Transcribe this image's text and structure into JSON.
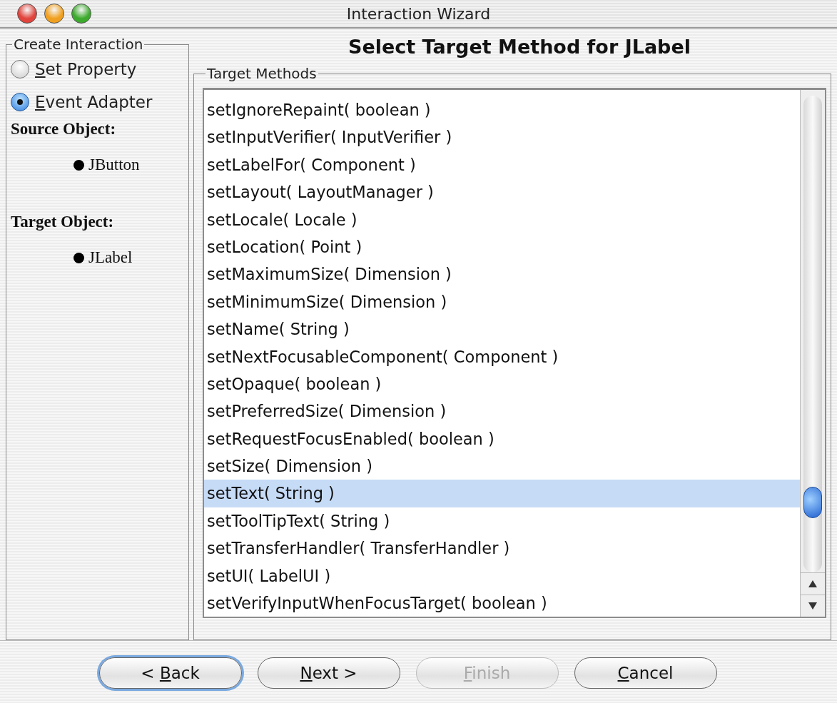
{
  "window": {
    "title": "Interaction Wizard"
  },
  "sidebar": {
    "group_title": "Create Interaction",
    "options": [
      {
        "key": "S",
        "post": "et Property",
        "selected": false
      },
      {
        "key": "E",
        "post": "vent Adapter",
        "selected": true
      }
    ],
    "source_label": "Source Object:",
    "source_value": "JButton",
    "target_label": "Target Object:",
    "target_value": "JLabel"
  },
  "heading": "Select Target Method for JLabel",
  "methods": {
    "group_title": "Target Methods",
    "rows": [
      {
        "text": "setIgnoreRepaint( boolean  )",
        "selected": false
      },
      {
        "text": "setInputVerifier( InputVerifier  )",
        "selected": false
      },
      {
        "text": "setLabelFor( Component  )",
        "selected": false
      },
      {
        "text": "setLayout( LayoutManager  )",
        "selected": false
      },
      {
        "text": "setLocale( Locale  )",
        "selected": false
      },
      {
        "text": "setLocation( Point  )",
        "selected": false
      },
      {
        "text": "setMaximumSize( Dimension  )",
        "selected": false
      },
      {
        "text": "setMinimumSize( Dimension  )",
        "selected": false
      },
      {
        "text": "setName( String  )",
        "selected": false
      },
      {
        "text": "setNextFocusableComponent( Component  )",
        "selected": false
      },
      {
        "text": "setOpaque( boolean  )",
        "selected": false
      },
      {
        "text": "setPreferredSize( Dimension  )",
        "selected": false
      },
      {
        "text": "setRequestFocusEnabled( boolean  )",
        "selected": false
      },
      {
        "text": "setSize( Dimension  )",
        "selected": false
      },
      {
        "text": "setText( String  )",
        "selected": true
      },
      {
        "text": "setToolTipText( String  )",
        "selected": false
      },
      {
        "text": "setTransferHandler( TransferHandler  )",
        "selected": false
      },
      {
        "text": "setUI( LabelUI  )",
        "selected": false
      },
      {
        "text": "setVerifyInputWhenFocusTarget( boolean  )",
        "selected": false
      }
    ]
  },
  "buttons": [
    {
      "pre": "< ",
      "key": "B",
      "post": "ack",
      "disabled": false,
      "default": true
    },
    {
      "key": "N",
      "post": "ext >",
      "disabled": false,
      "default": false
    },
    {
      "key": "F",
      "post": "inish",
      "disabled": true,
      "default": false
    },
    {
      "key": "C",
      "post": "ancel",
      "disabled": false,
      "default": false
    }
  ]
}
